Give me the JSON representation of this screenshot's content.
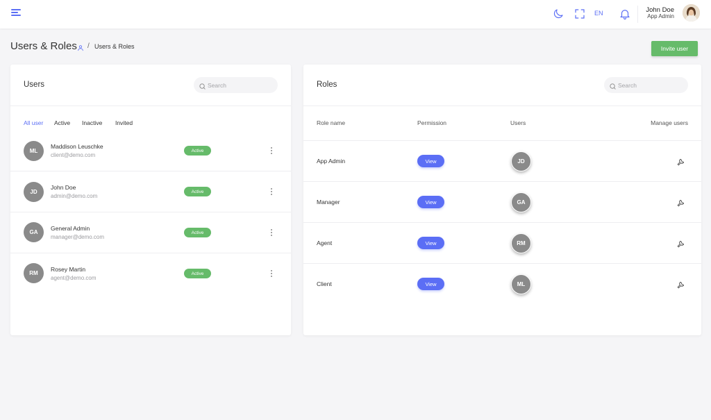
{
  "topbar": {
    "menu_icon": "hamburger-menu-icon",
    "theme_icon": "moon-icon",
    "fullscreen_icon": "fullscreen-icon",
    "language": "EN",
    "notification_icon": "bell-icon",
    "user_name": "John Doe",
    "user_role": "App Admin"
  },
  "page": {
    "title": "Users & Roles",
    "breadcrumb_icon": "user-icon",
    "breadcrumb_separator": "/",
    "breadcrumb_current": "Users & Roles",
    "invite_button": "Invite user"
  },
  "users_panel": {
    "title": "Users",
    "search_placeholder": "Search",
    "tabs": [
      "All user",
      "Active",
      "Inactive",
      "Invited"
    ],
    "active_tab": "All user",
    "users": [
      {
        "initials": "ML",
        "name": "Maddison Leuschke",
        "email": "client@demo.com",
        "status": "Active"
      },
      {
        "initials": "JD",
        "name": "John Doe",
        "email": "admin@demo.com",
        "status": "Active"
      },
      {
        "initials": "GA",
        "name": "General Admin",
        "email": "manager@demo.com",
        "status": "Active"
      },
      {
        "initials": "RM",
        "name": "Rosey Martin",
        "email": "agent@demo.com",
        "status": "Active"
      }
    ]
  },
  "roles_panel": {
    "title": "Roles",
    "search_placeholder": "Search",
    "columns": [
      "Role name",
      "Permission",
      "Users",
      "Manage users"
    ],
    "roles": [
      {
        "name": "App Admin",
        "permission": "View",
        "user_initials": "JD"
      },
      {
        "name": "Manager",
        "permission": "View",
        "user_initials": "GA"
      },
      {
        "name": "Agent",
        "permission": "View",
        "user_initials": "RM"
      },
      {
        "name": "Client",
        "permission": "View",
        "user_initials": "ML"
      }
    ]
  },
  "colors": {
    "accent": "#5b6ef5",
    "success": "#66bb6a",
    "avatar_bg": "#8a8a8a",
    "page_bg": "#f5f5f7"
  }
}
